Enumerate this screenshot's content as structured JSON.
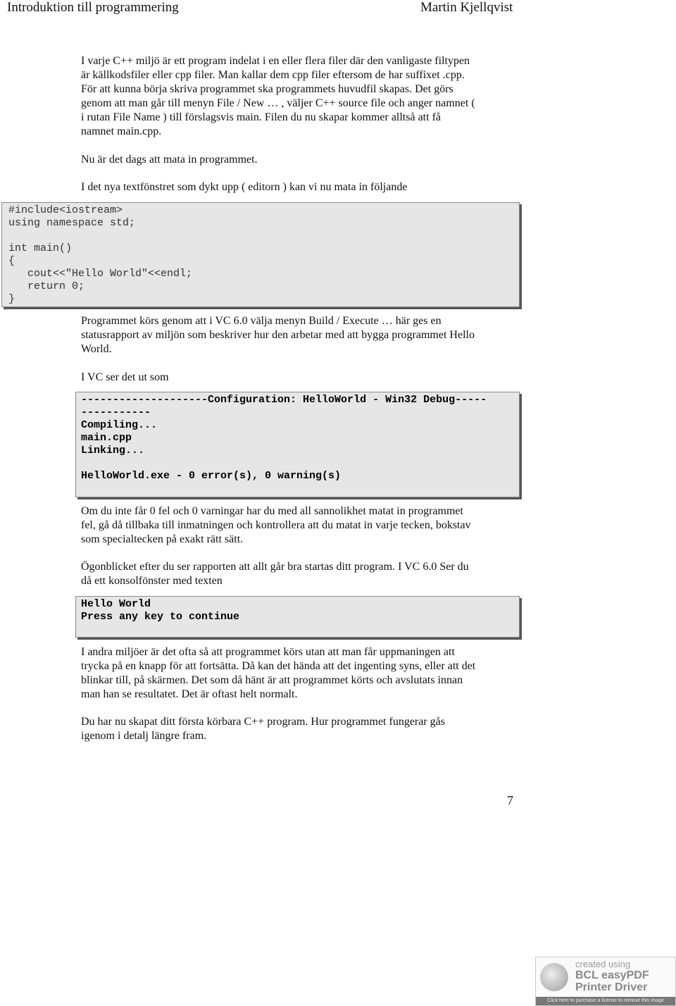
{
  "header": {
    "title": "Introduktion till programmering",
    "author": "Martin Kjellqvist"
  },
  "paragraphs": {
    "intro": [
      "I varje C++ miljö är ett program indelat i en eller flera filer där den vanligaste filtypen",
      "är källkodsfiler eller cpp filer. Man kallar dem cpp filer eftersom de har suffixet .cpp.",
      "För att kunna börja skriva programmet ska programmets huvudfil skapas. Det görs",
      "genom att man går till menyn File / New … , väljer C++ source file och anger namnet (",
      "i rutan File Name ) till förslagsvis main. Filen du nu skapar kommer alltså att få",
      "namnet main.cpp."
    ],
    "now": [
      "Nu är det dags att mata in programmet."
    ],
    "editor": [
      "I det nya textfönstret som dykt upp ( editorn ) kan vi nu mata in följande"
    ],
    "run": [
      "Programmet körs genom att i VC 6.0 välja menyn Build / Execute … här ges en",
      "statusrapport av miljön som beskriver hur den arbetar med att bygga programmet Hello",
      "World."
    ],
    "vc": [
      "I VC ser det ut som"
    ],
    "errors": [
      "Om du inte får 0 fel och 0 varningar har du med all sannolikhet matat in programmet",
      "fel, gå då tillbaka till inmatningen och kontrollera att du matat in varje tecken, bokstav",
      "som specialtecken på exakt rätt sätt."
    ],
    "moment": [
      "Ögonblicket efter du ser rapporten att allt går bra startas ditt program. I VC 6.0 Ser du",
      "då ett konsolfönster med texten"
    ],
    "other": [
      "I andra miljöer är det ofta så att programmet körs utan att man får uppmaningen att",
      "trycka på en knapp för att fortsätta. Då kan det hända att det ingenting syns, eller att det",
      "blinkar till, på skärmen. Det som då hänt är att programmet körts och avslutats innan",
      "man han se resultatet. Det är oftast helt normalt."
    ],
    "done": [
      "Du har nu skapat ditt första körbara C++ program. Hur programmet fungerar gås",
      "igenom i detalj längre fram."
    ]
  },
  "code_source": [
    "#include<iostream>",
    "using namespace std;",
    "",
    "int main()",
    "{",
    "   cout<<\"Hello World\"<<endl;",
    "   return 0;",
    "}"
  ],
  "code_build": [
    "--------------------Configuration: HelloWorld - Win32 Debug-----",
    "-----------",
    "Compiling...",
    "main.cpp",
    "Linking...",
    "",
    "HelloWorld.exe - 0 error(s), 0 warning(s)"
  ],
  "code_console": [
    "Hello World",
    "Press any key to continue"
  ],
  "page_number": "7",
  "watermark": {
    "line1": "created using",
    "line2": "BCL easyPDF",
    "line3": "Printer Driver",
    "footer": "Click here to purchase a license to remove this image"
  }
}
